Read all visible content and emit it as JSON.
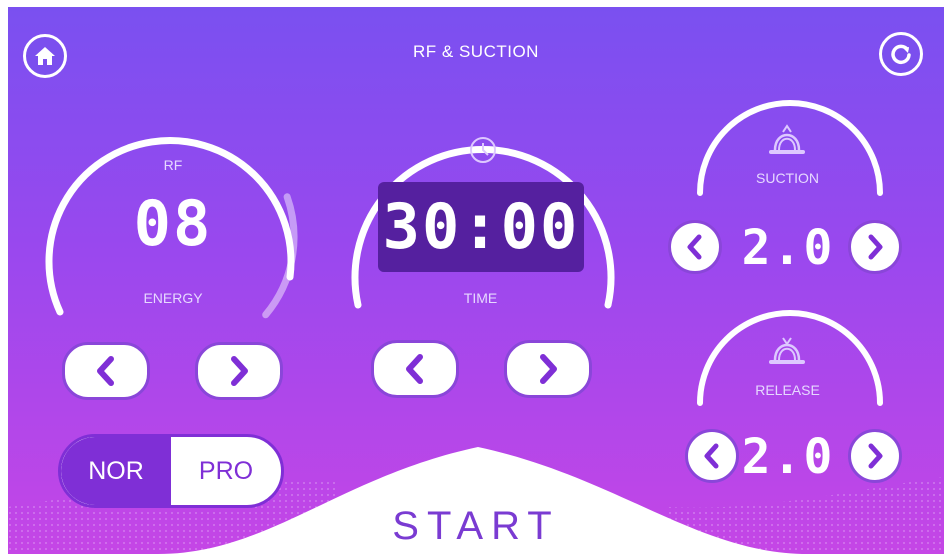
{
  "header": {
    "title": "RF & SUCTION"
  },
  "icons": {
    "home": "home-icon",
    "refresh": "refresh-icon",
    "clock": "clock-icon",
    "suction": "suction-cup-icon",
    "release": "release-cup-icon",
    "prev": "chevron-left-icon",
    "next": "chevron-right-icon"
  },
  "rf": {
    "title": "RF",
    "value": "08",
    "label": "ENERGY",
    "level": 0.33
  },
  "time": {
    "value": "30:00",
    "label": "TIME"
  },
  "suction": {
    "label": "SUCTION",
    "value": "2.0"
  },
  "release": {
    "label": "RELEASE",
    "value": "2.0"
  },
  "mode": {
    "options": [
      "NOR",
      "PRO"
    ],
    "selected": "NOR"
  },
  "start": {
    "label": "START"
  },
  "colors": {
    "accent": "#7f2fd6",
    "bg_top": "#7a50f0",
    "bg_bottom": "#c546e6",
    "timebox": "#55209f"
  }
}
